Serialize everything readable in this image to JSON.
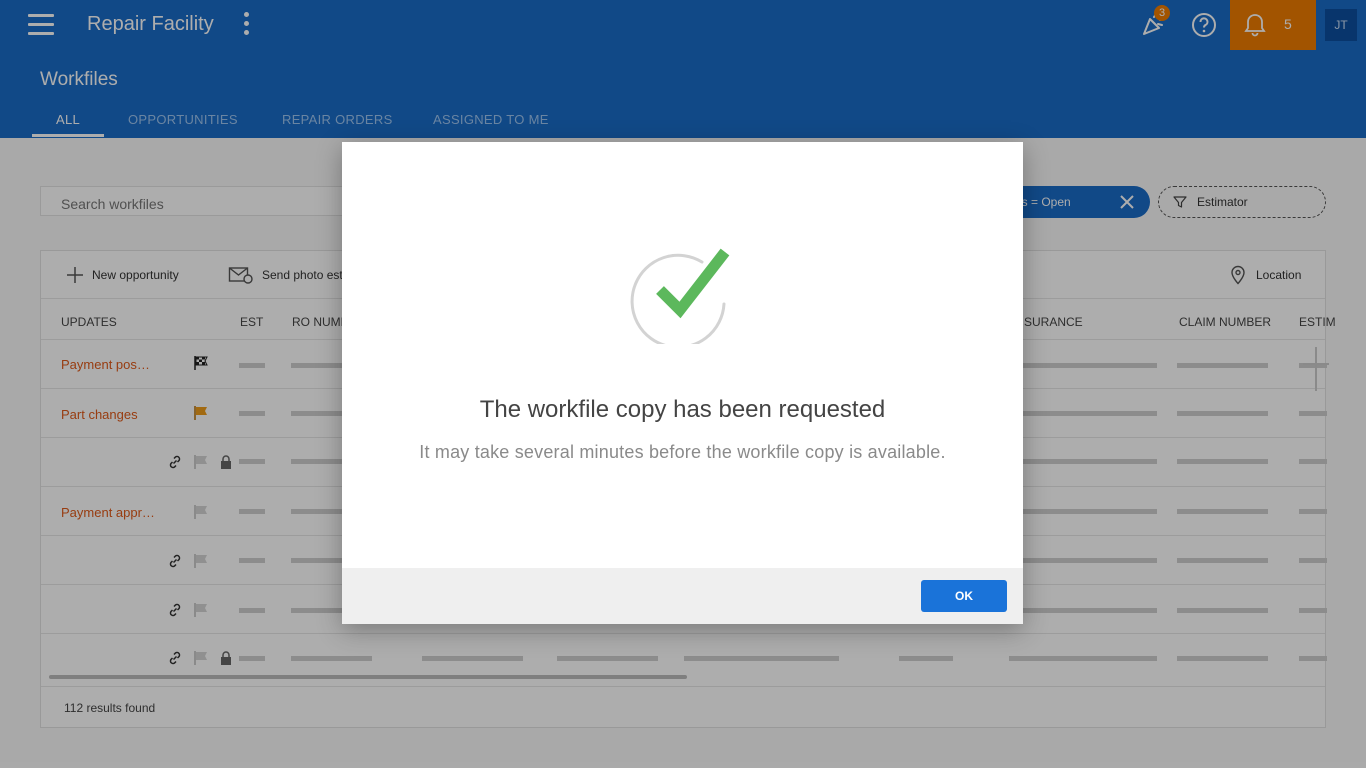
{
  "appbar": {
    "title": "Repair Facility",
    "celebrate_badge": "3",
    "notification_count": "5",
    "avatar_initials": "JT"
  },
  "page": {
    "title": "Workfiles",
    "tabs": [
      {
        "label": "ALL",
        "active": true
      },
      {
        "label": "OPPORTUNITIES",
        "active": false
      },
      {
        "label": "REPAIR ORDERS",
        "active": false
      },
      {
        "label": "ASSIGNED TO ME",
        "active": false
      }
    ]
  },
  "search": {
    "placeholder": "Search workfiles"
  },
  "filters": {
    "status_chip": "us = Open",
    "estimator_chip": "Estimator"
  },
  "toolbar": {
    "new_opportunity": "New opportunity",
    "send_photo": "Send photo est",
    "location": "Location"
  },
  "table": {
    "headers": {
      "updates": "UPDATES",
      "est": "EST",
      "ro_number": "RO NUMB",
      "insurance": "SURANCE",
      "claim_number": "CLAIM NUMBER",
      "estimator": "ESTIM"
    },
    "rows": [
      {
        "update": "Payment pos…"
      },
      {
        "update": "Part changes"
      },
      {
        "update": ""
      },
      {
        "update": "Payment appr…"
      },
      {
        "update": ""
      },
      {
        "update": ""
      },
      {
        "update": ""
      }
    ],
    "results": "112 results found"
  },
  "dialog": {
    "title": "The workfile copy has been requested",
    "message": "It may take several minutes before the workfile copy is available.",
    "ok_label": "OK",
    "check_color": "#5cb85c"
  },
  "colors": {
    "primary": "#1a6cc8",
    "accent": "#ef7d00",
    "update_text": "#e05a1a"
  }
}
